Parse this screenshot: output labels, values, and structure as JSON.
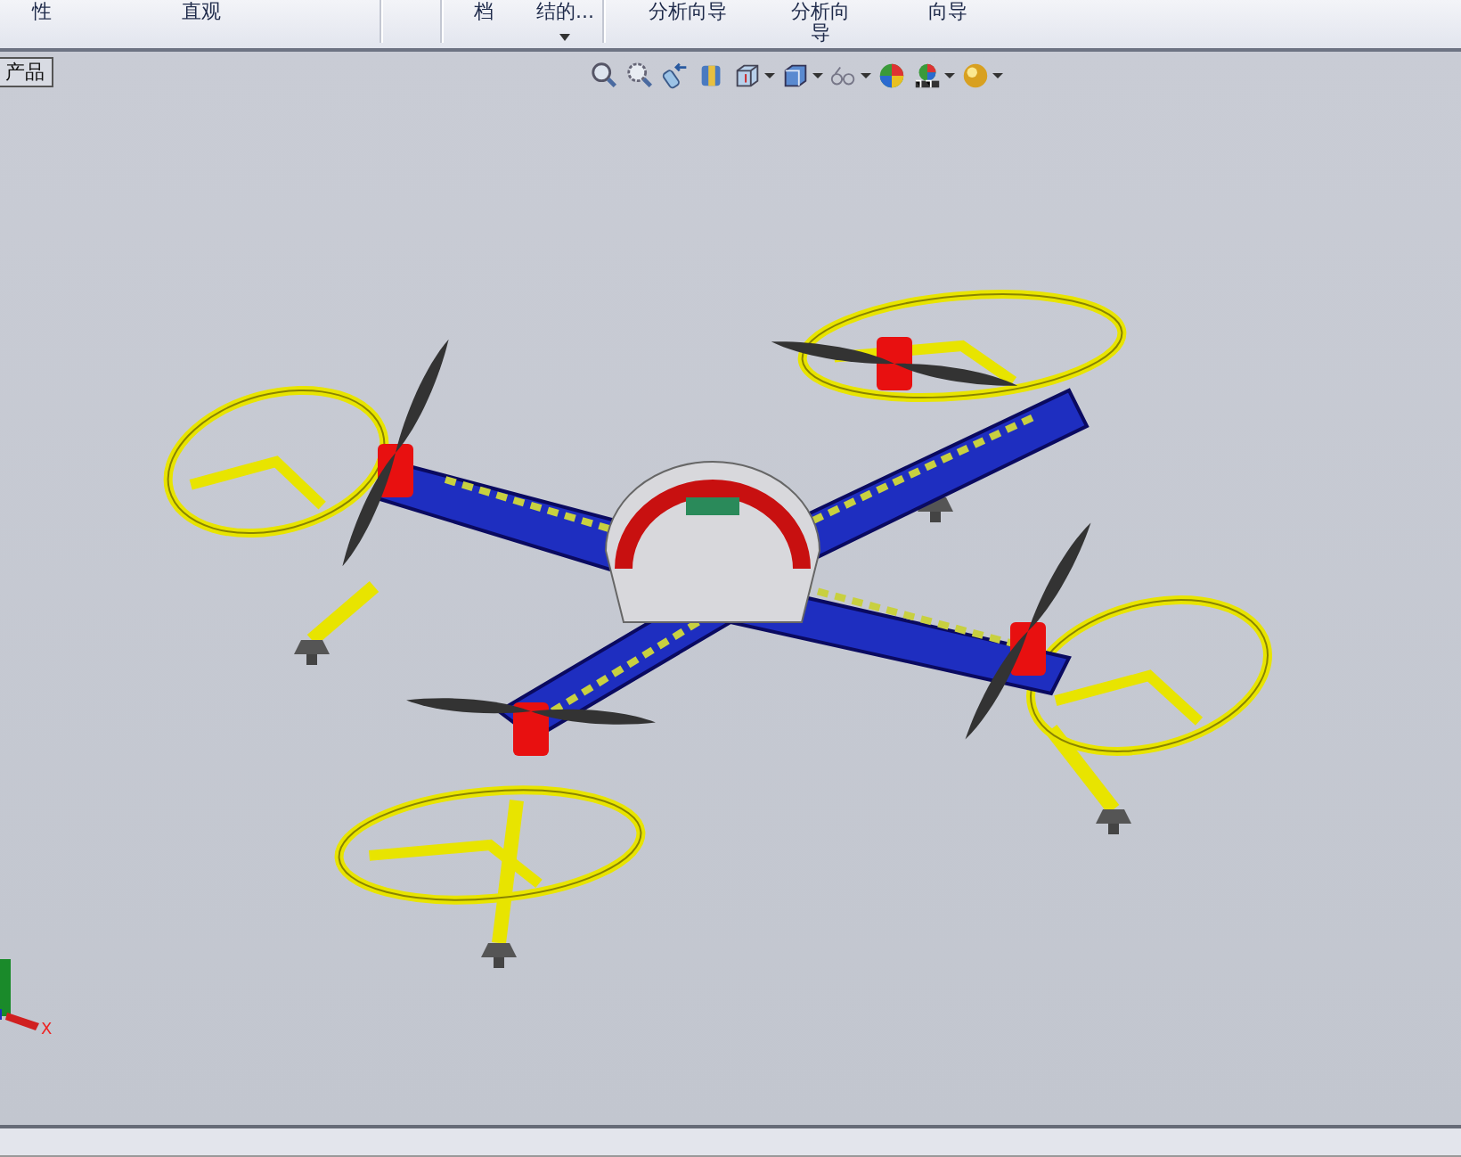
{
  "ribbon": {
    "buttons": [
      {
        "label": "性",
        "dropdown": false
      },
      {
        "label": "直观",
        "dropdown": false
      },
      {
        "label": "档",
        "dropdown": false
      },
      {
        "label": "结的...",
        "dropdown": true
      },
      {
        "label": "分析向导",
        "dropdown": false
      },
      {
        "label": "分析向导",
        "dropdown": false
      },
      {
        "label": "向导",
        "dropdown": false
      }
    ]
  },
  "document_tab": {
    "label": "产品"
  },
  "view_toolbar": {
    "tools": [
      {
        "kind": "zoom-fit",
        "dropdown": false
      },
      {
        "kind": "zoom-area",
        "dropdown": false
      },
      {
        "kind": "previous-view",
        "dropdown": false
      },
      {
        "kind": "section-view",
        "dropdown": false
      },
      {
        "kind": "view-orientation",
        "dropdown": true
      },
      {
        "kind": "display-style",
        "dropdown": true
      },
      {
        "kind": "hide-show",
        "dropdown": true
      },
      {
        "kind": "edit-appearance",
        "dropdown": false
      },
      {
        "kind": "scene",
        "dropdown": true
      },
      {
        "kind": "render",
        "dropdown": true
      }
    ]
  },
  "triad": {
    "x_label": "X"
  }
}
